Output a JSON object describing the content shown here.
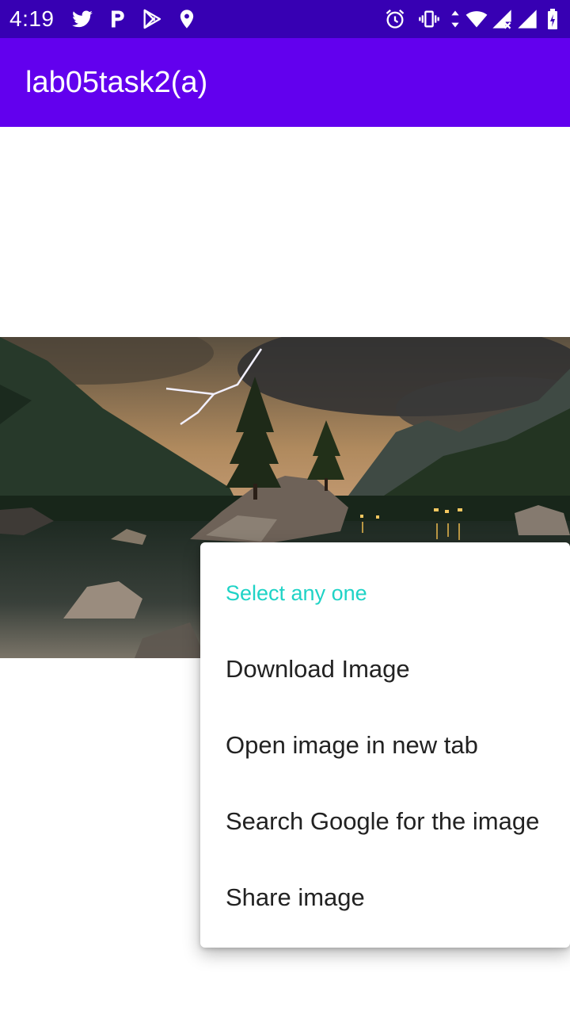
{
  "status_bar": {
    "time": "4:19",
    "left_icons": [
      "twitter-icon",
      "p-notification-icon",
      "play-store-icon",
      "location-icon"
    ],
    "right_icons": [
      "alarm-icon",
      "vibrate-icon",
      "data-arrows-icon",
      "wifi-icon",
      "signal-x-icon",
      "signal-icon",
      "battery-charging-icon"
    ],
    "background": "#3700b3"
  },
  "app_bar": {
    "title": "lab05task2(a)",
    "background": "#6200ee"
  },
  "image": {
    "description_icon": "landscape-image"
  },
  "context_menu": {
    "header": "Select any one",
    "header_color": "#1fd3c6",
    "items": [
      {
        "label": "Download Image"
      },
      {
        "label": "Open image in new tab"
      },
      {
        "label": "Search Google for the image"
      },
      {
        "label": "Share image"
      }
    ]
  }
}
